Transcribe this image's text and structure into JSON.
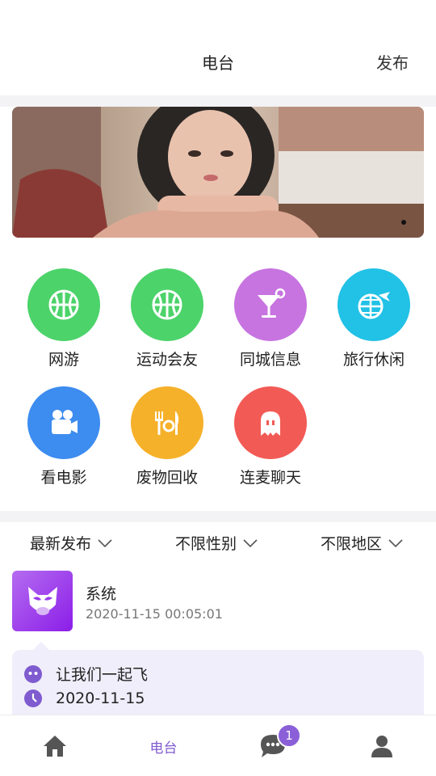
{
  "header": {
    "title": "电台",
    "publish_label": "发布"
  },
  "banner": {
    "slides_count": 1,
    "active_slide": 1
  },
  "categories": [
    {
      "label": "网游",
      "icon": "basketball-icon",
      "color": "#4cd36a"
    },
    {
      "label": "运动会友",
      "icon": "basketball-icon",
      "color": "#4cd36a"
    },
    {
      "label": "同城信息",
      "icon": "cocktail-icon",
      "color": "#c774e0"
    },
    {
      "label": "旅行休闲",
      "icon": "globe-plane-icon",
      "color": "#22c1e6"
    },
    {
      "label": "看电影",
      "icon": "movie-camera-icon",
      "color": "#3d8cf0"
    },
    {
      "label": "废物回收",
      "icon": "fork-knife-heart-icon",
      "color": "#f6b12a"
    },
    {
      "label": "连麦聊天",
      "icon": "ghost-icon",
      "color": "#f25a55"
    }
  ],
  "filters": [
    {
      "label": "最新发布"
    },
    {
      "label": "不限性别"
    },
    {
      "label": "不限地区"
    }
  ],
  "post": {
    "author": "系统",
    "time": "2020-11-15 00:05:01",
    "content": "让我们一起飞",
    "date": "2020-11-15",
    "accent_color": "#7f5bd0"
  },
  "tabbar": {
    "items": [
      {
        "name": "home",
        "icon": "home-icon"
      },
      {
        "name": "radio",
        "label": "电台"
      },
      {
        "name": "messages",
        "icon": "chat-bubble-icon",
        "badge": "1"
      },
      {
        "name": "profile",
        "icon": "user-icon"
      }
    ],
    "active_color": "#7f5bd0",
    "icon_color": "#555555"
  }
}
